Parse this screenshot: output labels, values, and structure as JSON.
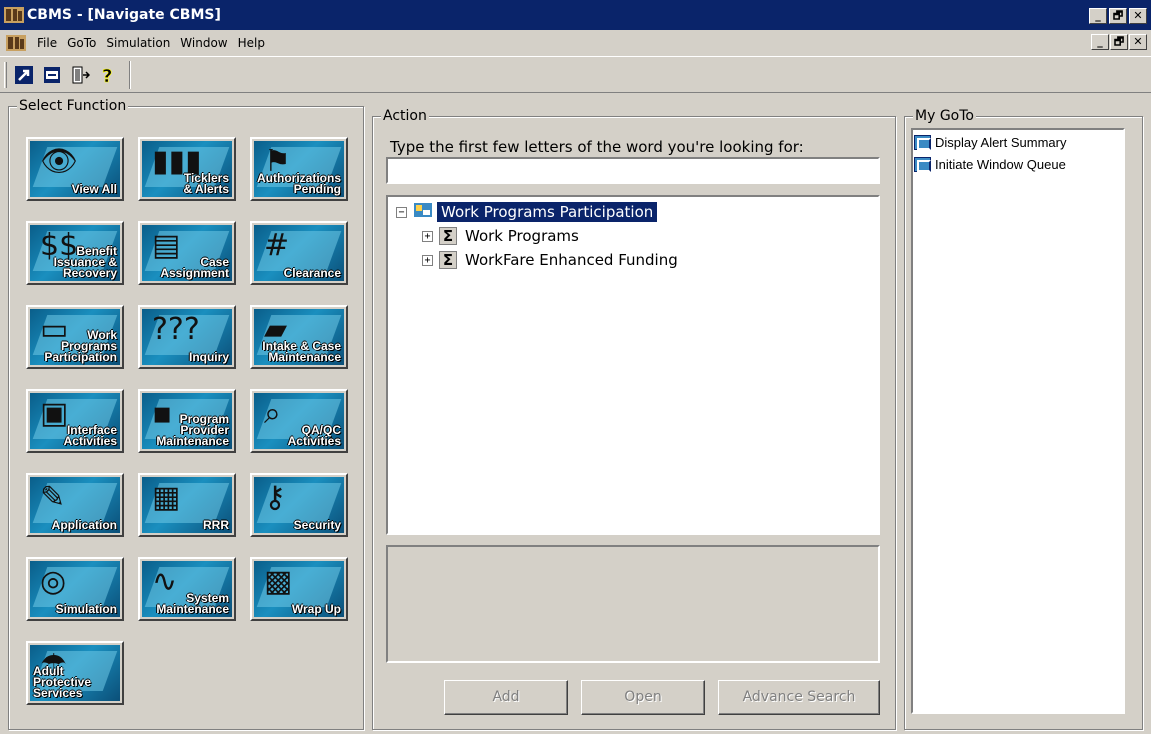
{
  "window": {
    "title": "CBMS - [Navigate CBMS]"
  },
  "menubar": {
    "items": [
      {
        "label": "File",
        "mnemonic": "F"
      },
      {
        "label": "GoTo",
        "mnemonic": "G"
      },
      {
        "label": "Simulation",
        "mnemonic": "S"
      },
      {
        "label": "Window",
        "mnemonic": "W"
      },
      {
        "label": "Help",
        "mnemonic": "H"
      }
    ]
  },
  "window_buttons": {
    "minimize": "_",
    "restore": "🗗",
    "close": "✕"
  },
  "toolbar": {
    "icons": [
      "navigate-icon",
      "window-icon",
      "exit-icon",
      "help-icon"
    ]
  },
  "select_function": {
    "legend": "Select Function",
    "buttons": [
      {
        "label": "View All",
        "icon": "eye-icon"
      },
      {
        "label": "Ticklers\n& Alerts",
        "icon": "ticklers-icon"
      },
      {
        "label": "Authorizations\nPending",
        "icon": "stamp-icon"
      },
      {
        "label": "Benefit\nIssuance &\nRecovery",
        "icon": "dollar-icon"
      },
      {
        "label": "Case\nAssignment",
        "icon": "clipboard-icon"
      },
      {
        "label": "Clearance",
        "icon": "gate-icon"
      },
      {
        "label": "Work\nPrograms\nParticipation",
        "icon": "briefcase-icon"
      },
      {
        "label": "Inquiry",
        "icon": "question-icon"
      },
      {
        "label": "Intake & Case\nMaintenance",
        "icon": "folder-icon"
      },
      {
        "label": "Interface\nActivities",
        "icon": "computer-icon"
      },
      {
        "label": "Program\nProvider\nMaintenance",
        "icon": "provider-icon"
      },
      {
        "label": "QA/QC\nActivities",
        "icon": "magnifier-icon"
      },
      {
        "label": "Application",
        "icon": "document-icon"
      },
      {
        "label": "RRR",
        "icon": "printer-icon"
      },
      {
        "label": "Security",
        "icon": "key-icon"
      },
      {
        "label": "Simulation",
        "icon": "camera-icon"
      },
      {
        "label": "System\nMaintenance",
        "icon": "chart-icon"
      },
      {
        "label": "Wrap Up",
        "icon": "boxes-icon"
      },
      {
        "label": "Adult\nProtective\nServices",
        "icon": "umbrella-icon"
      }
    ]
  },
  "action": {
    "legend": "Action",
    "prompt": "Type the first few letters of the word you're looking for:",
    "search_value": "",
    "tree": {
      "root": {
        "label": "Work Programs Participation",
        "expander": "−"
      },
      "children": [
        {
          "label": "Work Programs",
          "expander": "+",
          "icon": "Σ"
        },
        {
          "label": "WorkFare Enhanced Funding",
          "expander": "+",
          "icon": "Σ"
        }
      ]
    },
    "buttons": {
      "add": {
        "label": "Add",
        "mnemonic": "A"
      },
      "open": {
        "label": "Open",
        "mnemonic": "O"
      },
      "advance_search": {
        "label": "Advance Search",
        "mnemonic": "S"
      }
    }
  },
  "my_goto": {
    "legend": "My GoTo",
    "items": [
      "Display Alert Summary",
      "Initiate Window Queue"
    ]
  },
  "colors": {
    "title_bar": "#0a246a",
    "face": "#d4d0c8",
    "tile": "#1a8fbf",
    "selection": "#0a246a"
  }
}
